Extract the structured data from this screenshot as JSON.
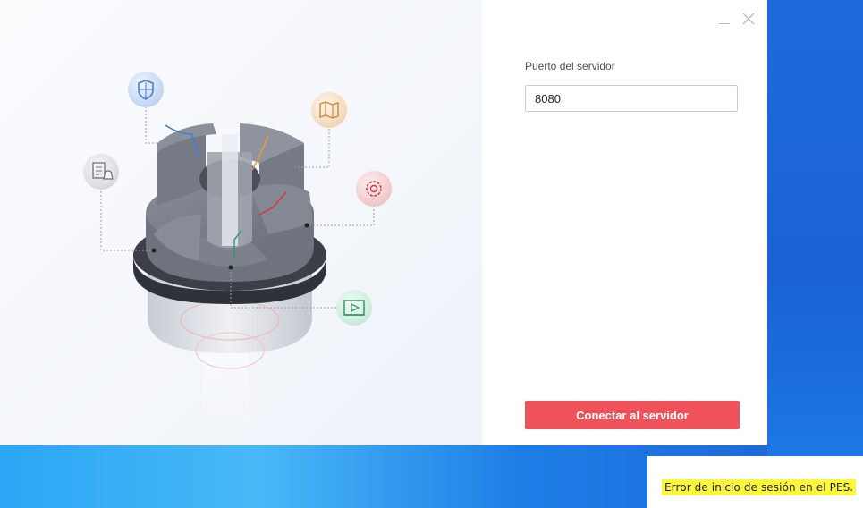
{
  "window": {
    "minimize_icon": "minimize-icon",
    "close_icon": "close-icon"
  },
  "hero": {
    "feature_icons": [
      "shield-icon",
      "map-icon",
      "document-bell-icon",
      "gear-icon",
      "video-icon"
    ]
  },
  "form": {
    "port_label": "Puerto del servidor",
    "port_value": "8080",
    "connect_label": "Conectar al servidor"
  },
  "notification": {
    "message": "Error de inicio de sesión en el PES."
  },
  "colors": {
    "accent": "#f0525c",
    "highlight": "#fdf73b"
  }
}
